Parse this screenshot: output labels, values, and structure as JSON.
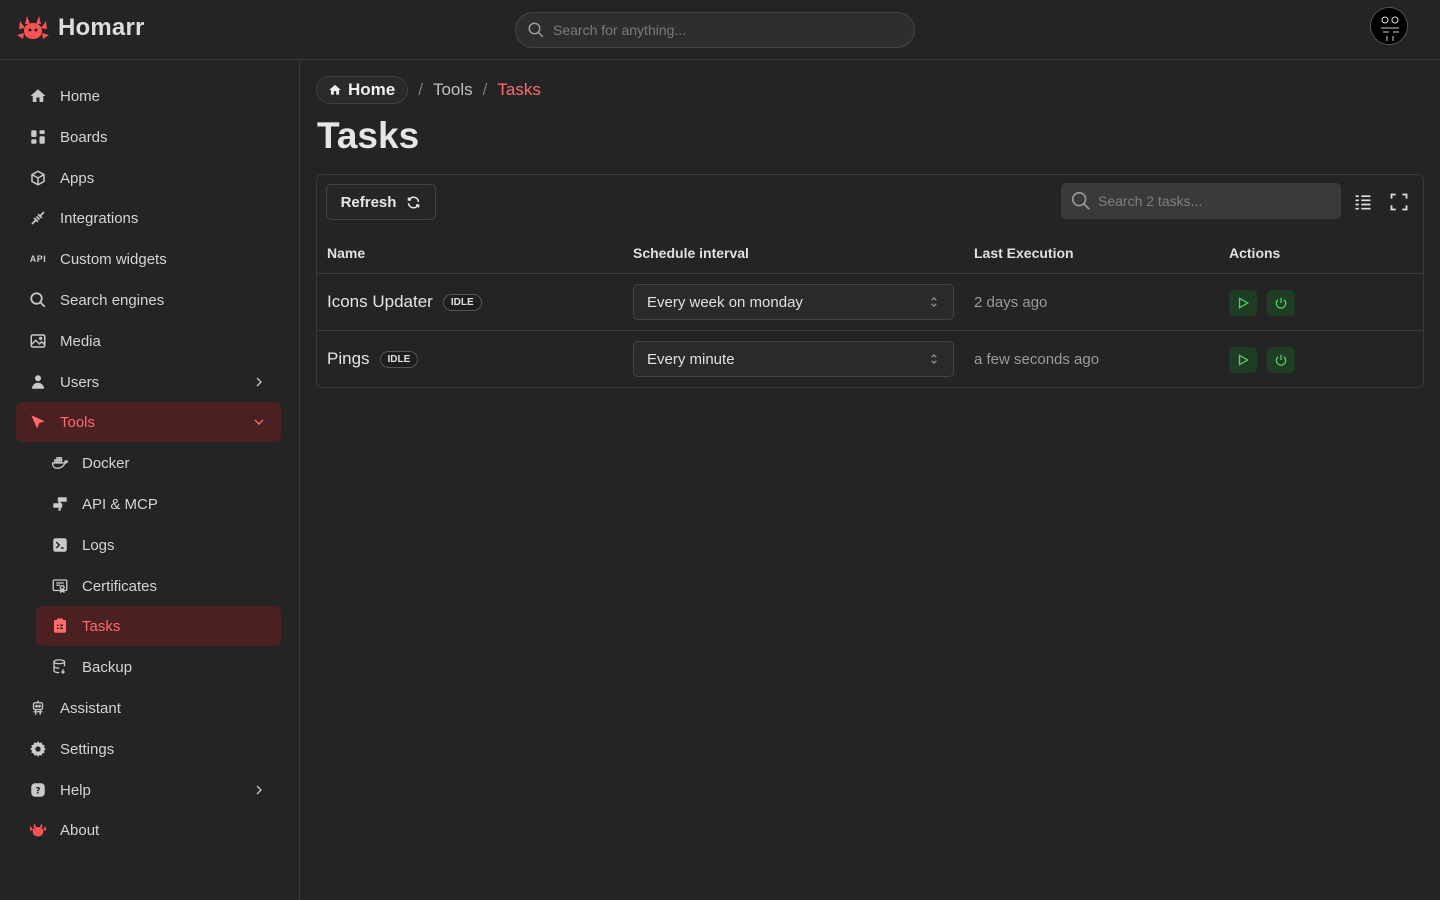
{
  "app": {
    "name": "Homarr"
  },
  "header": {
    "search_placeholder": "Search for anything..."
  },
  "sidebar": {
    "items": [
      {
        "label": "Home",
        "icon": "home-icon"
      },
      {
        "label": "Boards",
        "icon": "boards-icon"
      },
      {
        "label": "Apps",
        "icon": "box-icon"
      },
      {
        "label": "Integrations",
        "icon": "plug-icon"
      },
      {
        "label": "Custom widgets",
        "icon": "api-icon",
        "icon_text": "API"
      },
      {
        "label": "Search engines",
        "icon": "search-icon"
      },
      {
        "label": "Media",
        "icon": "photo-icon"
      },
      {
        "label": "Users",
        "icon": "user-icon"
      },
      {
        "label": "Tools",
        "icon": "tools-icon"
      },
      {
        "label": "Docker",
        "icon": "docker-icon"
      },
      {
        "label": "API & MCP",
        "icon": "api-mcp-icon"
      },
      {
        "label": "Logs",
        "icon": "terminal-icon"
      },
      {
        "label": "Certificates",
        "icon": "certificate-icon"
      },
      {
        "label": "Tasks",
        "icon": "report-icon"
      },
      {
        "label": "Backup",
        "icon": "database-icon"
      },
      {
        "label": "Assistant",
        "icon": "robot-icon"
      },
      {
        "label": "Settings",
        "icon": "gear-icon"
      },
      {
        "label": "Help",
        "icon": "help-icon"
      },
      {
        "label": "About",
        "icon": "homarr-logo-icon"
      }
    ]
  },
  "breadcrumb": {
    "home": "Home",
    "sep": "/",
    "tools": "Tools",
    "current": "Tasks"
  },
  "page": {
    "title": "Tasks"
  },
  "table": {
    "refresh_label": "Refresh",
    "search_placeholder": "Search 2 tasks...",
    "columns": [
      "Name",
      "Schedule interval",
      "Last Execution",
      "Actions"
    ],
    "rows": [
      {
        "name": "Icons Updater",
        "status": "IDLE",
        "interval": "Every week on monday",
        "last_execution": "2 days ago"
      },
      {
        "name": "Pings",
        "status": "IDLE",
        "interval": "Every minute",
        "last_execution": "a few seconds ago"
      }
    ]
  },
  "colors": {
    "accent": "#ff6b6b",
    "active_bg": "#4a2022",
    "action_bg": "#1f3d24",
    "action_fg": "#51cf66"
  }
}
